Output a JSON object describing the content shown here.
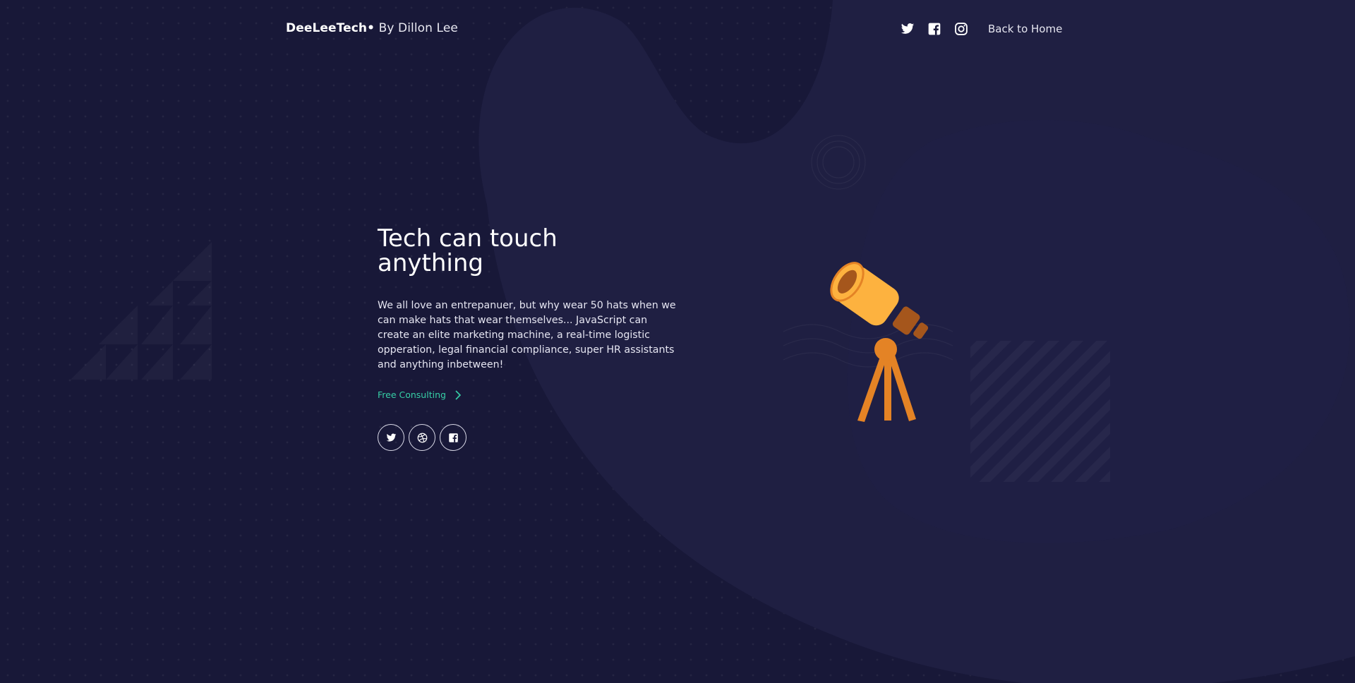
{
  "header": {
    "brand_name": "DeeLeeTech•",
    "brand_by": " By Dillon Lee",
    "icons": [
      "twitter-icon",
      "facebook-icon",
      "instagram-icon"
    ],
    "back_home": "Back to Home"
  },
  "hero": {
    "title": "Tech can touch anything",
    "body": "We all love an entrepanuer, but why wear 50 hats when we can make hats that wear themselves... JavaScript can create an elite marketing machine, a real-time logistic opperation, legal financial compliance, super HR assistants and anything inbetween!",
    "cta": "Free Consulting",
    "socials": [
      "twitter-icon",
      "dribbble-icon",
      "facebook-icon"
    ]
  },
  "colors": {
    "background": "#181838",
    "blob": "#1f1f42",
    "accent": "#36cfa6",
    "telescope_main": "#fdb23f",
    "telescope_dark": "#a5561c",
    "telescope_stand": "#e48325"
  }
}
